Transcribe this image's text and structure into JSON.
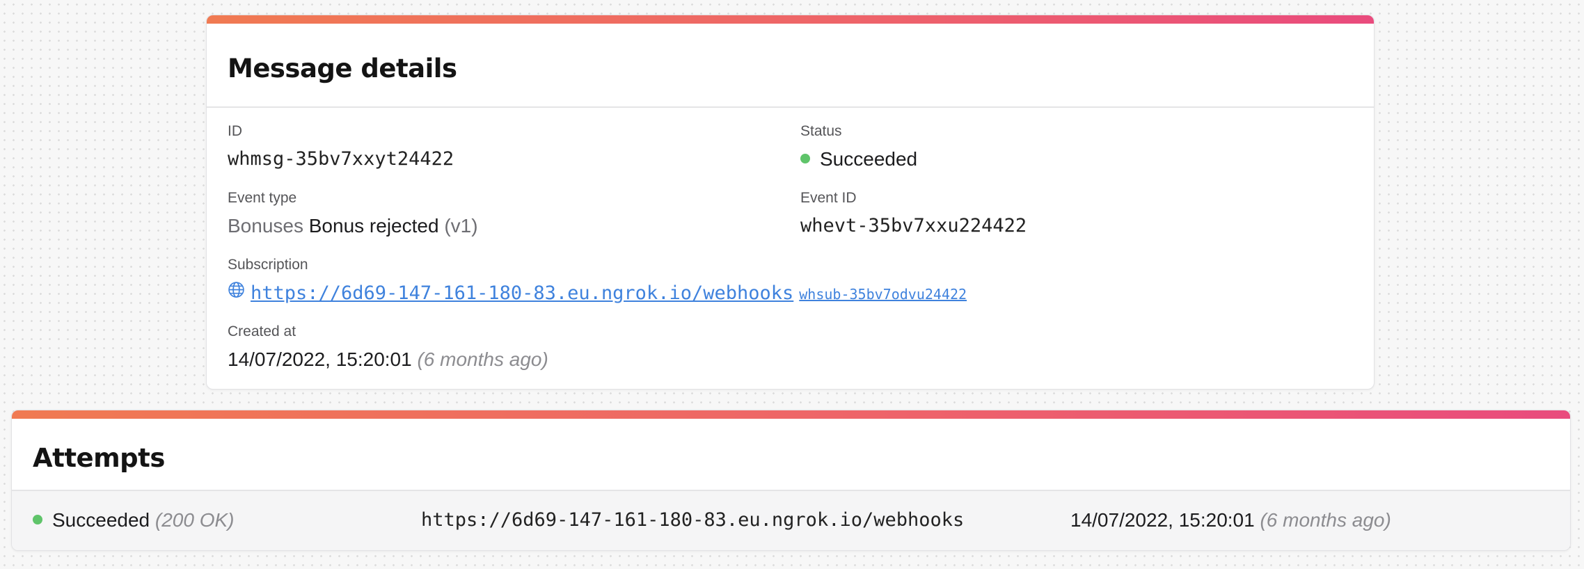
{
  "details": {
    "title": "Message details",
    "id_label": "ID",
    "id_value": "whmsg-35bv7xxyt24422",
    "status_label": "Status",
    "status_value": "Succeeded",
    "event_type_label": "Event type",
    "event_type_group": "Bonuses",
    "event_type_name": "Bonus rejected",
    "event_type_version": "(v1)",
    "event_id_label": "Event ID",
    "event_id_value": "whevt-35bv7xxu224422",
    "subscription_label": "Subscription",
    "subscription_url": "https://6d69-147-161-180-83.eu.ngrok.io/webhooks",
    "subscription_id": "whsub-35bv7odvu24422",
    "created_label": "Created at",
    "created_value": "14/07/2022, 15:20:01",
    "created_ago": "(6 months ago)"
  },
  "attempts": {
    "title": "Attempts",
    "rows": [
      {
        "status": "Succeeded",
        "code": "(200 OK)",
        "url": "https://6d69-147-161-180-83.eu.ngrok.io/webhooks",
        "time": "14/07/2022, 15:20:01",
        "ago": "(6 months ago)"
      }
    ]
  },
  "colors": {
    "success": "#5fc46a",
    "link": "#3f82dd",
    "accent_start": "#f07a52",
    "accent_end": "#e94b7d"
  },
  "icons": {
    "status": "status-dot-icon",
    "subscription": "globe-icon"
  }
}
